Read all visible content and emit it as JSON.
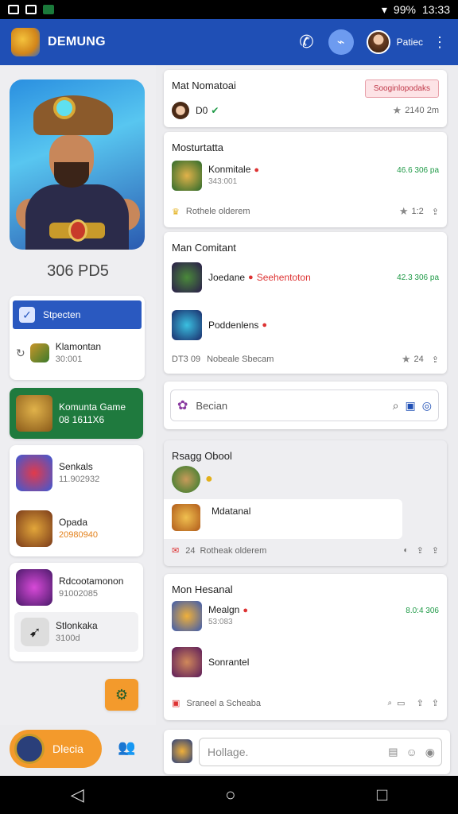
{
  "status": {
    "battery": "99%",
    "time": "13:33"
  },
  "appbar": {
    "title": "DEMUNG",
    "user": "Patiec"
  },
  "left": {
    "stat": "306 PD5",
    "selected_label": "Stpecten",
    "item1": {
      "title": "Klamontan",
      "sub": "30:001"
    },
    "game": {
      "title": "Komunta Game",
      "sub": "08 1611X6"
    },
    "item2": {
      "title": "Senkals",
      "sub": "11.902932"
    },
    "item3": {
      "title": "Opada",
      "sub": "20980940"
    },
    "item4": {
      "title": "Rdcootamonon",
      "sub": "91002085"
    },
    "item5": {
      "title": "Stlonkaka",
      "sub": "3100d"
    },
    "bottom_btn": "Dlecia"
  },
  "main": {
    "card1": {
      "title": "Mat Nomatoai",
      "pill": "Sooginlopodaks",
      "row": "D0",
      "meta": "2140 2m"
    },
    "card2": {
      "title": "Mosturtatta",
      "row_title": "Konmitale",
      "row_sub": "343:001",
      "right": "46.6 306 pa",
      "foot": "Rothele olderem",
      "meta": "1:2"
    },
    "card3": {
      "title": "Man Comitant",
      "row1_title": "Joedane",
      "row1_tag": "Seehentoton",
      "row1_right": "42.3 306 pa",
      "row2_title": "Poddenlens",
      "foot_code": "DT3 09",
      "foot": "Nobeale Sbecam",
      "meta": "24"
    },
    "search": {
      "placeholder": "Becian"
    },
    "card4": {
      "title": "Rsagg Obool",
      "row_title": "Mdatanal",
      "foot_code": "24",
      "foot": "Rotheak olderem"
    },
    "card5": {
      "title": "Mon Hesanal",
      "row1_title": "Mealgn",
      "row1_sub": "53:083",
      "right": "8.0:4 306",
      "row2_title": "Sonrantel",
      "foot": "Sraneel a Scheaba"
    }
  },
  "composer": {
    "placeholder": "Hollage."
  }
}
